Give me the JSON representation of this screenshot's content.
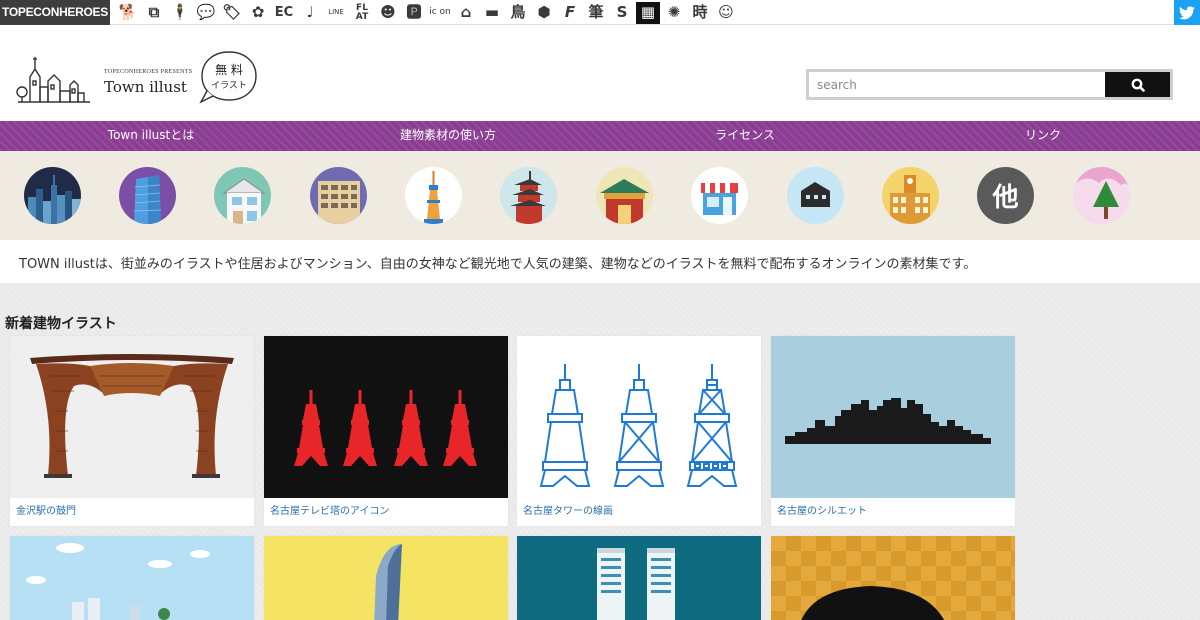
{
  "network_bar": {
    "brand": "TOPECONHEROES",
    "icons": [
      {
        "name": "dog-icon",
        "glyph": "🐕"
      },
      {
        "name": "copy-icon",
        "glyph": "⧉"
      },
      {
        "name": "person-icon",
        "glyph": "🕴"
      },
      {
        "name": "speech-bubble-icon",
        "glyph": "💬"
      },
      {
        "name": "tag-icon",
        "glyph": "🏷"
      },
      {
        "name": "flower-icon",
        "glyph": "✿"
      },
      {
        "name": "ec-icon",
        "glyph": "EC"
      },
      {
        "name": "music-note-icon",
        "glyph": "♩"
      },
      {
        "name": "line-icon",
        "glyph": "LINE"
      },
      {
        "name": "flat-icon",
        "glyph": "FL AT"
      },
      {
        "name": "smiley-icon",
        "glyph": "☻"
      },
      {
        "name": "parking-icon",
        "glyph": "🅿"
      },
      {
        "name": "icon-on-icon",
        "glyph": "ic on"
      },
      {
        "name": "town-icon",
        "glyph": "⌂"
      },
      {
        "name": "bed-icon",
        "glyph": "▬"
      },
      {
        "name": "bird-kanji-icon",
        "glyph": "鳥"
      },
      {
        "name": "hexagon-icon",
        "glyph": "⬢"
      },
      {
        "name": "f-icon",
        "glyph": "F"
      },
      {
        "name": "brush-kanji-icon",
        "glyph": "筆"
      },
      {
        "name": "s-icon",
        "glyph": "S"
      },
      {
        "name": "grid-icon",
        "glyph": "▦"
      },
      {
        "name": "burst-icon",
        "glyph": "✺"
      },
      {
        "name": "time-kanji-icon",
        "glyph": "時"
      },
      {
        "name": "face-icon",
        "glyph": "☺"
      }
    ]
  },
  "header": {
    "presents": "TOPECONHEROES PRESENTS",
    "site_name": "Town illust",
    "badge_line1": "無 料",
    "badge_line2": "イラスト"
  },
  "search": {
    "placeholder": "search"
  },
  "nav": {
    "items": [
      {
        "label": "Town illustとは"
      },
      {
        "label": "建物素材の使い方"
      },
      {
        "label": "ライセンス"
      },
      {
        "label": "リンク"
      }
    ]
  },
  "categories": [
    {
      "name": "category-city-skyline",
      "icon": "skyline-icon"
    },
    {
      "name": "category-skyscraper",
      "icon": "skyscraper-icon"
    },
    {
      "name": "category-house",
      "icon": "house-icon"
    },
    {
      "name": "category-apartment",
      "icon": "apartment-icon"
    },
    {
      "name": "category-tower",
      "icon": "tower-icon"
    },
    {
      "name": "category-temple",
      "icon": "pagoda-icon"
    },
    {
      "name": "category-shrine",
      "icon": "shrine-icon"
    },
    {
      "name": "category-shop",
      "icon": "shop-icon"
    },
    {
      "name": "category-warehouse",
      "icon": "warehouse-icon"
    },
    {
      "name": "category-school",
      "icon": "school-icon"
    },
    {
      "name": "category-other",
      "icon": "other-icon",
      "label": "他"
    },
    {
      "name": "category-nature",
      "icon": "tree-icon"
    }
  ],
  "description": "TOWN illustは、街並みのイラストや住居およびマンション、自由の女神など観光地で人気の建築、建物などのイラストを無料で配布するオンラインの素材集です。",
  "section": {
    "title": "新着建物イラスト"
  },
  "cards": [
    {
      "caption": "金沢駅の鼓門",
      "bg": "#efefef"
    },
    {
      "caption": "名古屋テレビ塔のアイコン",
      "bg": "#111111"
    },
    {
      "caption": "名古屋タワーの線画",
      "bg": "#ffffff"
    },
    {
      "caption": "名古屋のシルエット",
      "bg": "#a9cfde"
    },
    {
      "caption": "",
      "bg": "#b8e0f5"
    },
    {
      "caption": "",
      "bg": "#f5e463"
    },
    {
      "caption": "",
      "bg": "#0f6b80"
    },
    {
      "caption": "",
      "bg": "#e3a93c"
    }
  ],
  "colors": {
    "nav_purple": "#8a3d92",
    "caption_blue": "#2a6fb0",
    "twitter_blue": "#1da1f2"
  }
}
